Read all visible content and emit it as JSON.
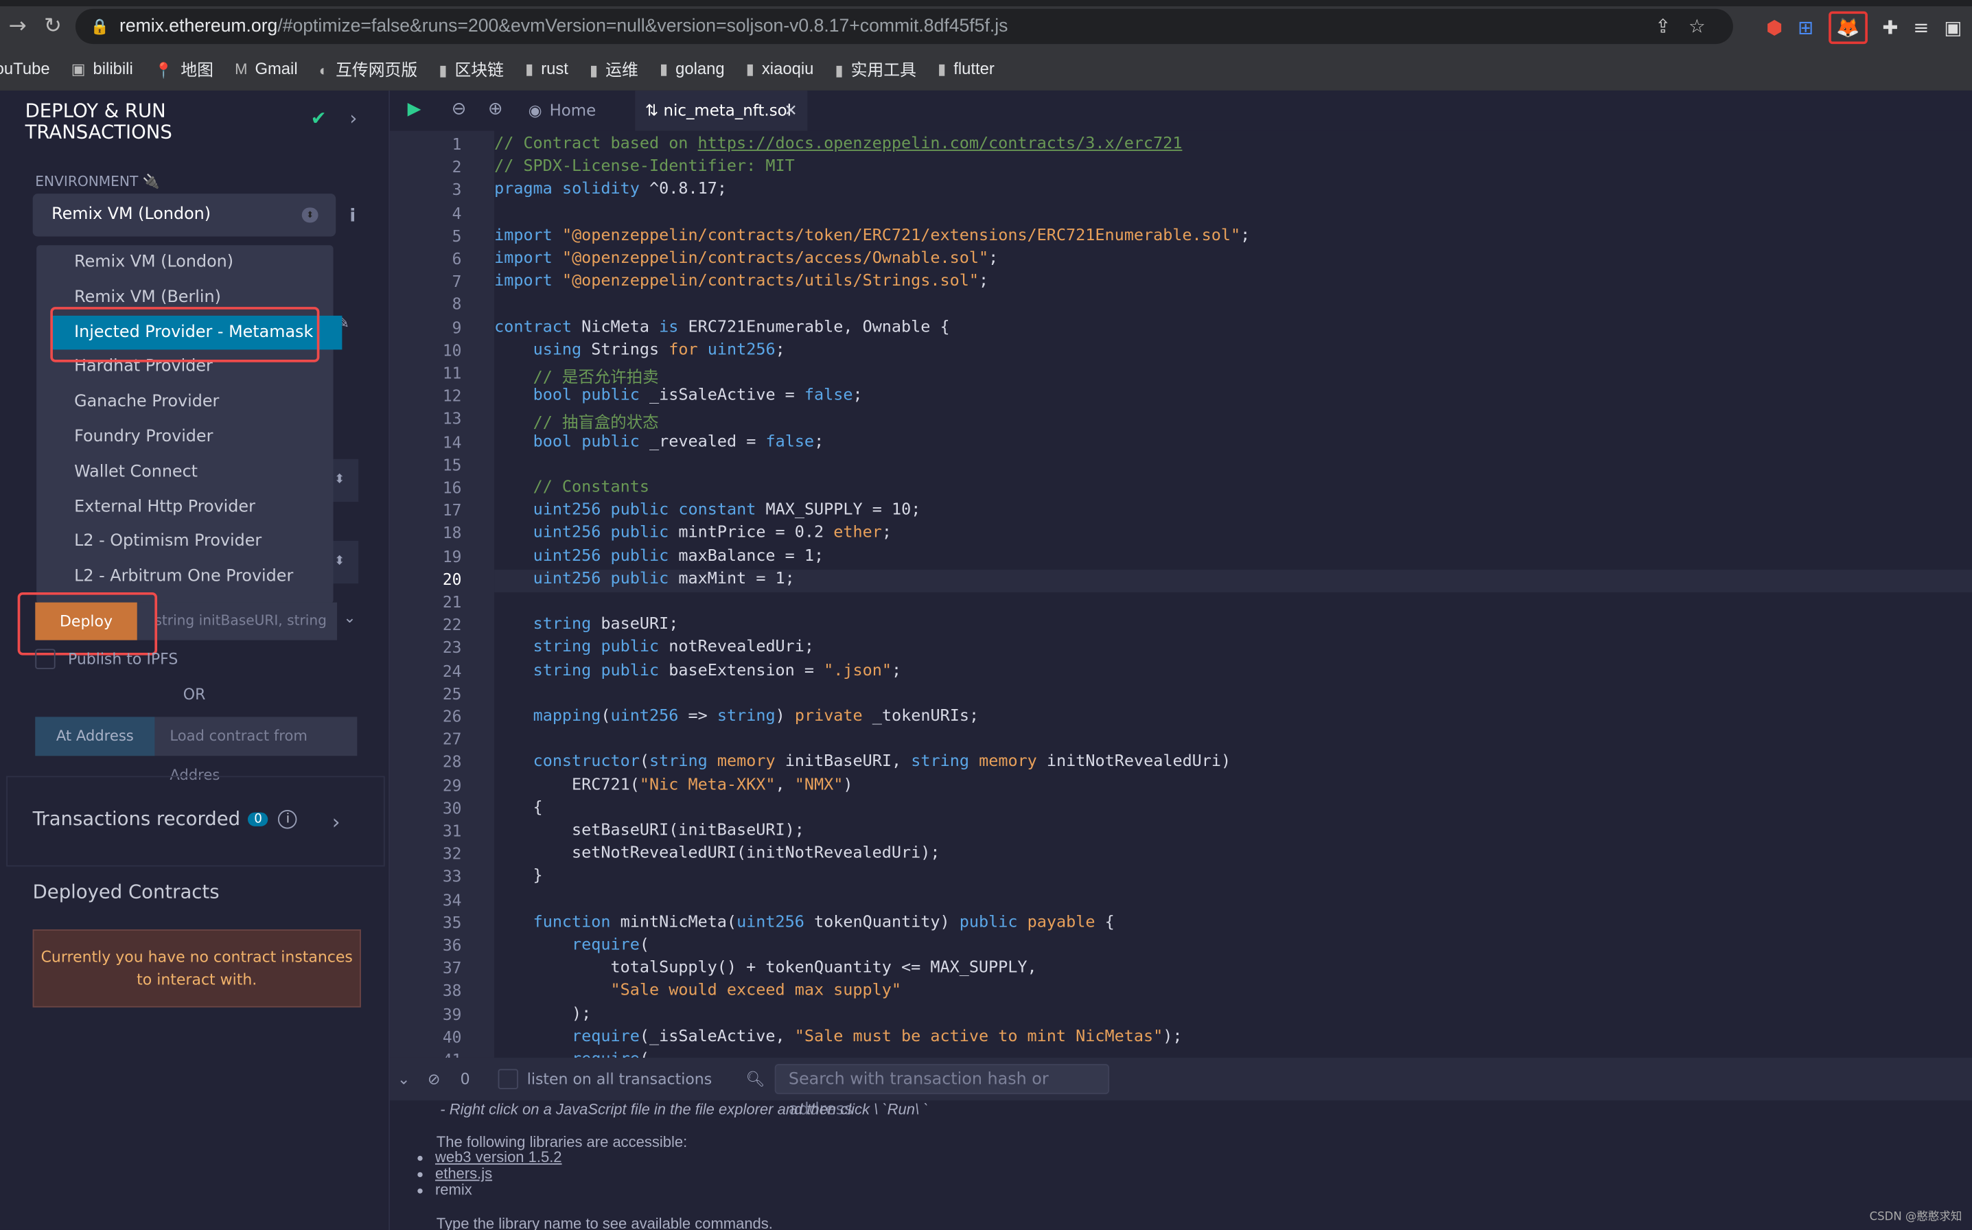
{
  "browser": {
    "url_host": "remix.ethereum.org",
    "url_rest": "/#optimize=false&runs=200&evmVersion=null&version=soljson-v0.8.17+commit.8df45f5f.js",
    "bookmarks": [
      "ouTube",
      "bilibili",
      "地图",
      "Gmail",
      "互传网页版",
      "区块链",
      "rust",
      "运维",
      "golang",
      "xiaoqiu",
      "实用工具",
      "flutter"
    ]
  },
  "sidebar": {
    "title_line1": "DEPLOY & RUN",
    "title_line2": "TRANSACTIONS",
    "environment_label": "ENVIRONMENT",
    "environment_value": "Remix VM (London)",
    "options": [
      "Remix VM (London)",
      "Remix VM (Berlin)",
      "Injected Provider - Metamask",
      "Hardhat Provider",
      "Ganache Provider",
      "Foundry Provider",
      "Wallet Connect",
      "External Http Provider",
      "L2 - Optimism Provider",
      "L2 - Arbitrum One Provider"
    ],
    "highlighted_option": "Injected Provider - Metamask",
    "deploy_label": "Deploy",
    "deploy_placeholder": "string initBaseURI, string ir",
    "publish_ipfs": "Publish to IPFS",
    "or": "OR",
    "at_address": "At Address",
    "load_placeholder": "Load contract from Addres",
    "transactions_recorded": "Transactions recorded",
    "tx_count": "0",
    "deployed_contracts": "Deployed Contracts",
    "no_contracts": "Currently you have no contract instances to interact with."
  },
  "editor": {
    "home_tab": "Home",
    "file_tab": "nic_meta_nft.sol",
    "current_line": 20,
    "lines": [
      "// Contract based on https://docs.openzeppelin.com/contracts/3.x/erc721",
      "// SPDX-License-Identifier: MIT",
      "pragma solidity ^0.8.17;",
      "",
      "import \"@openzeppelin/contracts/token/ERC721/extensions/ERC721Enumerable.sol\";",
      "import \"@openzeppelin/contracts/access/Ownable.sol\";",
      "import \"@openzeppelin/contracts/utils/Strings.sol\";",
      "",
      "contract NicMeta is ERC721Enumerable, Ownable {",
      "    using Strings for uint256;",
      "    // 是否允许拍卖",
      "    bool public _isSaleActive = false;",
      "    // 抽盲盒的状态",
      "    bool public _revealed = false;",
      "",
      "    // Constants",
      "    uint256 public constant MAX_SUPPLY = 10;",
      "    uint256 public mintPrice = 0.2 ether;",
      "    uint256 public maxBalance = 1;",
      "    uint256 public maxMint = 1;",
      "",
      "    string baseURI;",
      "    string public notRevealedUri;",
      "    string public baseExtension = \".json\";",
      "",
      "    mapping(uint256 => string) private _tokenURIs;",
      "",
      "    constructor(string memory initBaseURI, string memory initNotRevealedUri)",
      "        ERC721(\"Nic Meta-XKX\", \"NMX\")",
      "    {",
      "        setBaseURI(initBaseURI);",
      "        setNotRevealedURI(initNotRevealedUri);",
      "    }",
      "",
      "    function mintNicMeta(uint256 tokenQuantity) public payable {",
      "        require(",
      "            totalSupply() + tokenQuantity <= MAX_SUPPLY,",
      "            \"Sale would exceed max supply\"",
      "        );",
      "        require(_isSaleActive, \"Sale must be active to mint NicMetas\");",
      "        require("
    ]
  },
  "terminal": {
    "count": "0",
    "listen_label": "listen on all transactions",
    "search_placeholder": "Search with transaction hash or address",
    "hint": "- Right click on a JavaScript file in the file explorer and then click \\ `Run\\ `",
    "libs_intro": "The following libraries are accessible:",
    "libs": [
      "web3 version 1.5.2",
      "ethers.js",
      "remix"
    ],
    "type_hint": "Type the library name to see available commands."
  },
  "watermark": "CSDN @憨憨求知",
  "colors": {
    "accent": "#007aa6",
    "deploy": "#c97539",
    "highlight_box": "#ee4b4b"
  }
}
